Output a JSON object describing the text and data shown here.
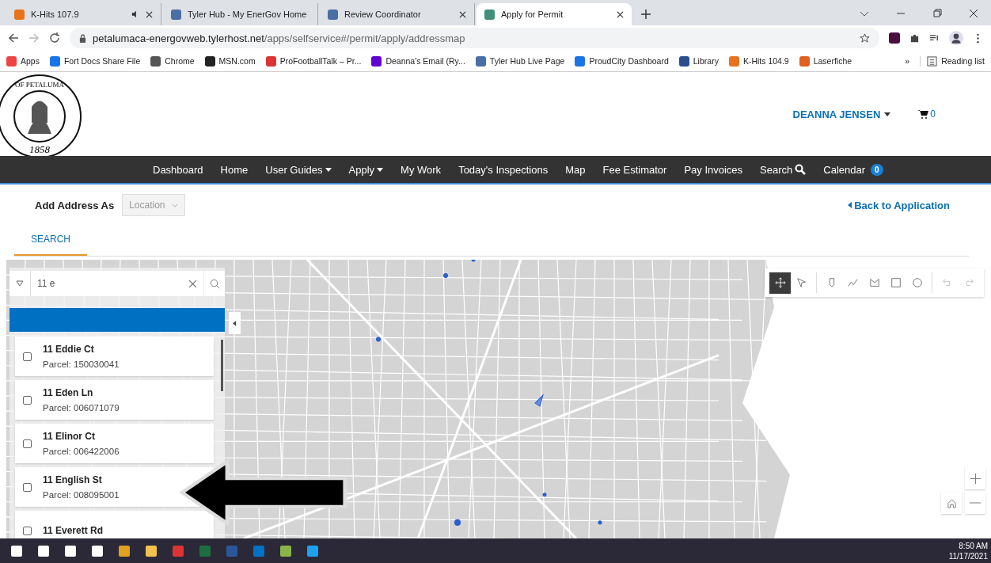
{
  "browser": {
    "tabs": [
      {
        "title": "K-Hits 107.9",
        "selected": false,
        "audio": true
      },
      {
        "title": "Tyler Hub - My EnerGov Home",
        "selected": false,
        "audio": false
      },
      {
        "title": "Review Coordinator",
        "selected": false,
        "audio": false
      },
      {
        "title": "Apply for Permit",
        "selected": true,
        "audio": false
      }
    ],
    "url_host": "petalumaca-energovweb.tylerhost.net",
    "url_path": "/apps/selfservice#/permit/apply/addressmap",
    "bookmarks": [
      {
        "label": "Apps"
      },
      {
        "label": "Fort Docs Share File"
      },
      {
        "label": "Chrome"
      },
      {
        "label": "MSN.com"
      },
      {
        "label": "ProFootballTalk – Pr..."
      },
      {
        "label": "Deanna's Email (Ry..."
      },
      {
        "label": "Tyler Hub Live Page"
      },
      {
        "label": "ProudCity Dashboard"
      },
      {
        "label": "Library"
      },
      {
        "label": "K-Hits 104.9"
      },
      {
        "label": "Laserfiche"
      }
    ],
    "more": "»",
    "reading_list": "Reading list"
  },
  "header": {
    "seal_text": "OF PETALUMA",
    "seal_year": "1858",
    "user": "DEANNA JENSEN",
    "cart_count": "0"
  },
  "nav": [
    {
      "label": "Dashboard",
      "kind": "link"
    },
    {
      "label": "Home",
      "kind": "link"
    },
    {
      "label": "User Guides",
      "kind": "dropdown"
    },
    {
      "label": "Apply",
      "kind": "dropdown"
    },
    {
      "label": "My Work",
      "kind": "link"
    },
    {
      "label": "Today's Inspections",
      "kind": "link"
    },
    {
      "label": "Map",
      "kind": "link"
    },
    {
      "label": "Fee Estimator",
      "kind": "link"
    },
    {
      "label": "Pay Invoices",
      "kind": "link"
    },
    {
      "label": "Search",
      "kind": "search"
    },
    {
      "label": "Calendar",
      "kind": "badge",
      "badge": "0"
    }
  ],
  "add_address": {
    "label": "Add Address As",
    "value": "Location"
  },
  "back_link": "Back to Application",
  "tabs": [
    {
      "label": "SEARCH",
      "selected": true
    }
  ],
  "map": {
    "search": {
      "value": "11 e"
    },
    "results": [
      {
        "address": "11 Eddie Ct",
        "parcel": "Parcel: 150030041",
        "checked": false
      },
      {
        "address": "11 Eden Ln",
        "parcel": "Parcel: 006071079",
        "checked": false
      },
      {
        "address": "11 Elinor Ct",
        "parcel": "Parcel: 006422006",
        "checked": false
      },
      {
        "address": "11 English St",
        "parcel": "Parcel: 008095001",
        "checked": false
      },
      {
        "address": "11 Everett Rd",
        "checked": false
      }
    ],
    "tools": [
      {
        "kind": "pan",
        "selected": true
      },
      {
        "kind": "select",
        "selected": false
      },
      {
        "kind": "sep"
      },
      {
        "kind": "point",
        "selected": false
      },
      {
        "kind": "line",
        "selected": false
      },
      {
        "kind": "polygon",
        "selected": false
      },
      {
        "kind": "rect",
        "selected": false
      },
      {
        "kind": "circle",
        "selected": false
      },
      {
        "kind": "sep"
      },
      {
        "kind": "undo",
        "selected": false
      },
      {
        "kind": "redo",
        "selected": false
      }
    ]
  },
  "taskbar": {
    "time": "8:50 AM",
    "date": "11/17/2021"
  }
}
